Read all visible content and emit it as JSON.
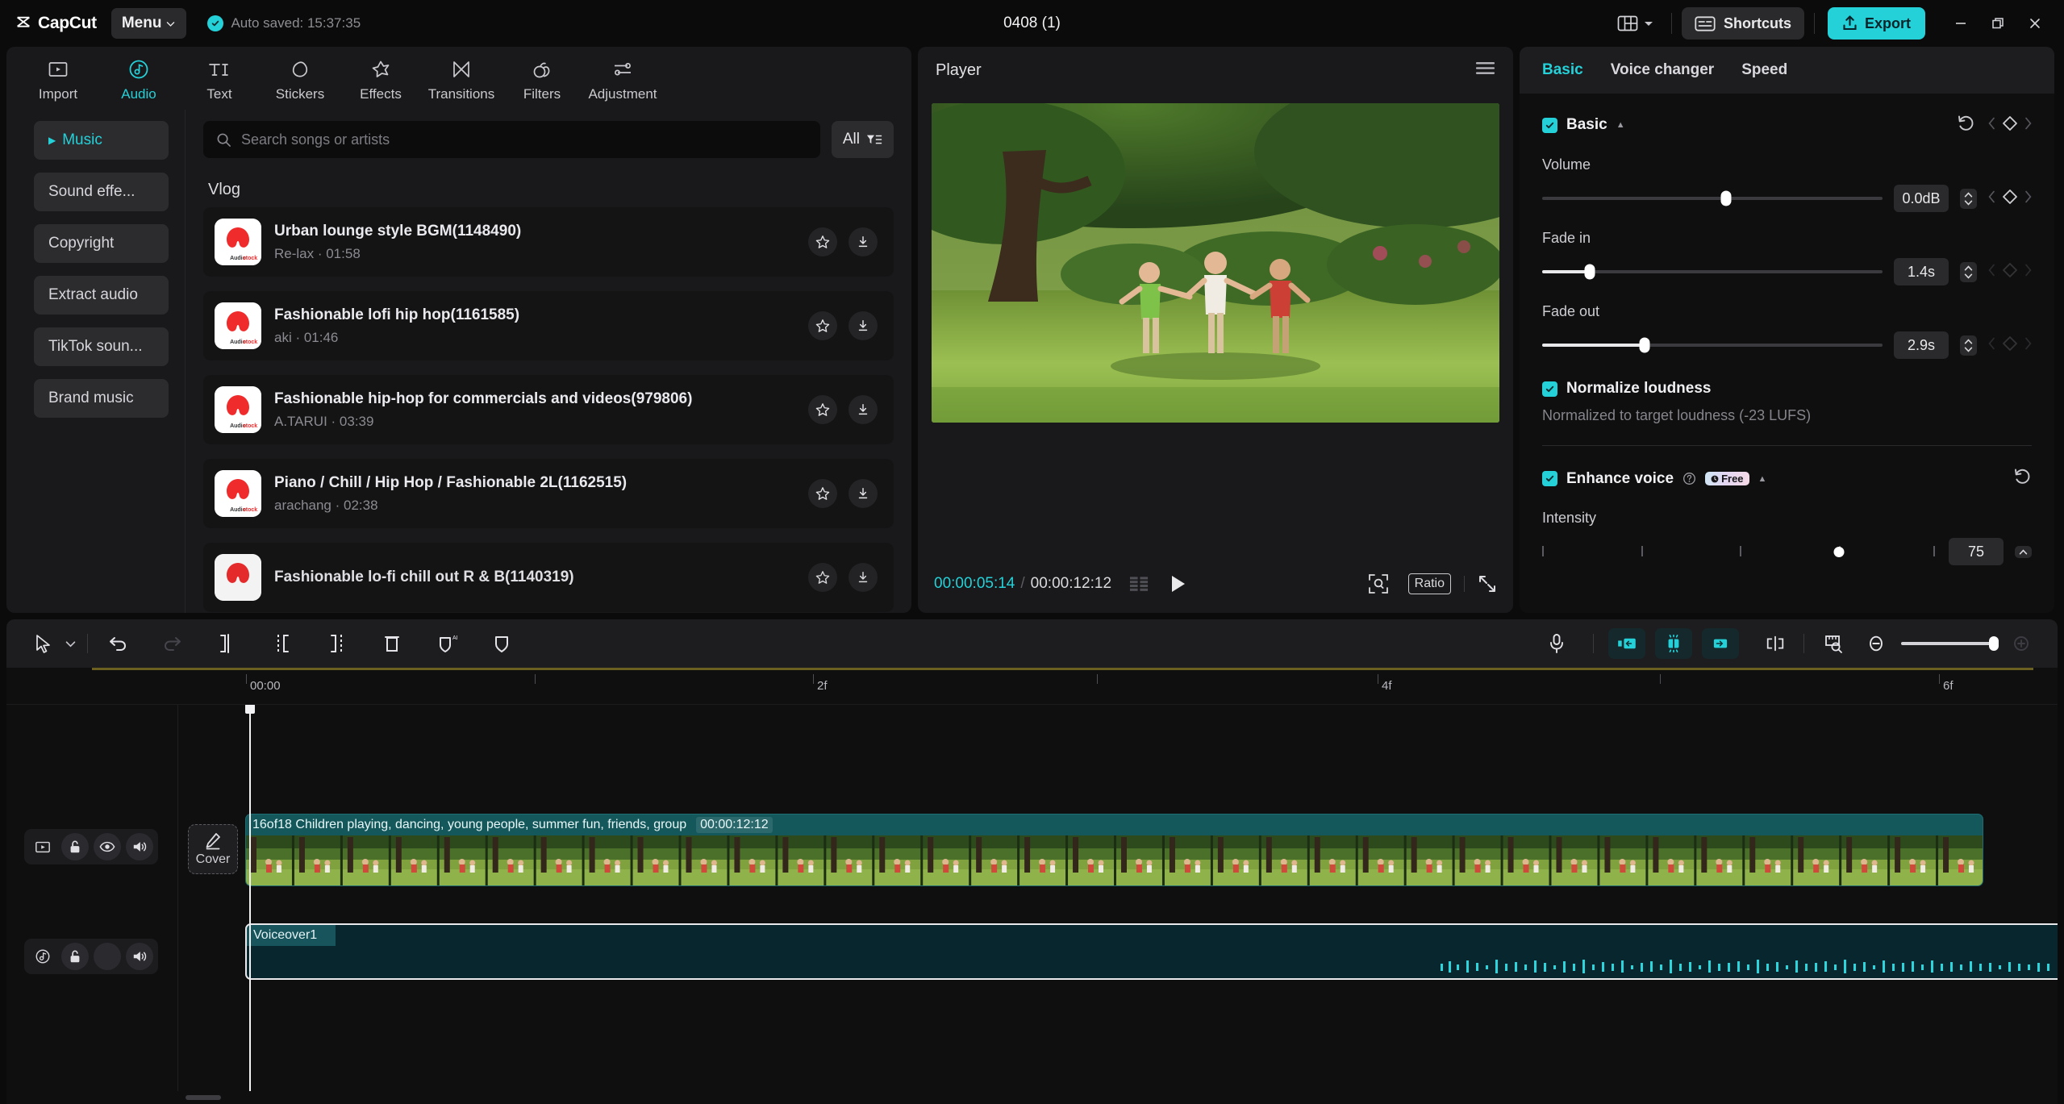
{
  "titlebar": {
    "app_name": "CapCut",
    "menu_label": "Menu",
    "autosave_text": "Auto saved: 15:37:35",
    "project_title": "0408 (1)",
    "shortcuts_label": "Shortcuts",
    "export_label": "Export",
    "accent_color": "#25d1d8"
  },
  "modebar": {
    "items": [
      {
        "label": "Import",
        "icon": "import-icon",
        "active": false
      },
      {
        "label": "Audio",
        "icon": "audio-note-icon",
        "active": true
      },
      {
        "label": "Text",
        "icon": "text-ti-icon",
        "active": false
      },
      {
        "label": "Stickers",
        "icon": "sticker-drop-icon",
        "active": false
      },
      {
        "label": "Effects",
        "icon": "effects-star-icon",
        "active": false
      },
      {
        "label": "Transitions",
        "icon": "transitions-bowtie-icon",
        "active": false
      },
      {
        "label": "Filters",
        "icon": "filters-circles-icon",
        "active": false
      },
      {
        "label": "Adjustment",
        "icon": "adjustment-sliders-icon",
        "active": false
      }
    ]
  },
  "categories": [
    {
      "label": "Music",
      "active": true
    },
    {
      "label": "Sound effe...",
      "active": false
    },
    {
      "label": "Copyright",
      "active": false
    },
    {
      "label": "Extract audio",
      "active": false
    },
    {
      "label": "TikTok soun...",
      "active": false
    },
    {
      "label": "Brand music",
      "active": false
    }
  ],
  "search": {
    "placeholder": "Search songs or artists",
    "value": "",
    "filter_label": "All"
  },
  "songs": {
    "group_title": "Vlog",
    "items": [
      {
        "title": "Urban lounge style BGM(1148490)",
        "artist": "Re-lax",
        "duration": "01:58",
        "meta": "Re-lax · 01:58",
        "thumb_label": "Audiostock"
      },
      {
        "title": "Fashionable lofi hip hop(1161585)",
        "artist": "aki",
        "duration": "01:46",
        "meta": "aki · 01:46",
        "thumb_label": "Audiostock"
      },
      {
        "title": "Fashionable hip-hop for commercials and videos(979806)",
        "artist": "A.TARUI",
        "duration": "03:39",
        "meta": "A.TARUI · 03:39",
        "thumb_label": "Audiostock"
      },
      {
        "title": "Piano / Chill / Hip Hop / Fashionable 2L(1162515)",
        "artist": "arachang",
        "duration": "02:38",
        "meta": "arachang · 02:38",
        "thumb_label": "Audiostock"
      },
      {
        "title": "Fashionable lo-fi chill out R & B(1140319)",
        "artist": "",
        "duration": "",
        "meta": "",
        "thumb_label": "Audiostock"
      }
    ]
  },
  "player": {
    "title": "Player",
    "current_time": "00:00:05:14",
    "separator": "/",
    "total_time": "00:00:12:12",
    "ratio_label": "Ratio"
  },
  "right_panel": {
    "tabs": [
      {
        "label": "Basic",
        "active": true
      },
      {
        "label": "Voice changer",
        "active": false
      },
      {
        "label": "Speed",
        "active": false
      }
    ],
    "basic_section": {
      "title": "Basic",
      "checked": true,
      "params": [
        {
          "label": "Volume",
          "value": "0.0dB",
          "percent": 54
        },
        {
          "label": "Fade in",
          "value": "1.4s",
          "percent": 14
        },
        {
          "label": "Fade out",
          "value": "2.9s",
          "percent": 30
        }
      ]
    },
    "normalize": {
      "label": "Normalize loudness",
      "checked": true,
      "note": "Normalized to target loudness (-23 LUFS)"
    },
    "enhance": {
      "label": "Enhance voice",
      "checked": true,
      "badge": "Free",
      "intensity_label": "Intensity",
      "intensity_value": "75",
      "intensity_percent": 75
    }
  },
  "timeline": {
    "toolbar": {
      "left_icons": [
        "select-arrow-icon",
        "dropdown-caret-icon",
        "undo-icon",
        "redo-icon",
        "split-icon",
        "trim-left-icon",
        "trim-right-icon",
        "delete-icon",
        "ai-mask-icon",
        "mask-icon"
      ],
      "right_icons": [
        "microphone-icon",
        "snap-left-icon",
        "auto-fit-icon",
        "snap-right-icon",
        "split-playhead-icon",
        "ruler-icon",
        "zoom-out-icon",
        "zoom-slider",
        "zoom-in-icon"
      ]
    },
    "ruler_labels": [
      "00:00",
      "2f",
      "4f",
      "6f"
    ],
    "video_track": {
      "clip_label": "16of18 Children playing, dancing, young people, summer fun, friends, group",
      "clip_duration": "00:00:12:12",
      "cover_label": "Cover",
      "head_icons": [
        "video-track-icon",
        "lock-icon",
        "eye-icon",
        "speaker-icon"
      ]
    },
    "audio_track": {
      "clip_label": "Voiceover1",
      "head_icons": [
        "audio-track-icon",
        "lock-icon",
        "blank-icon",
        "speaker-icon"
      ]
    }
  }
}
